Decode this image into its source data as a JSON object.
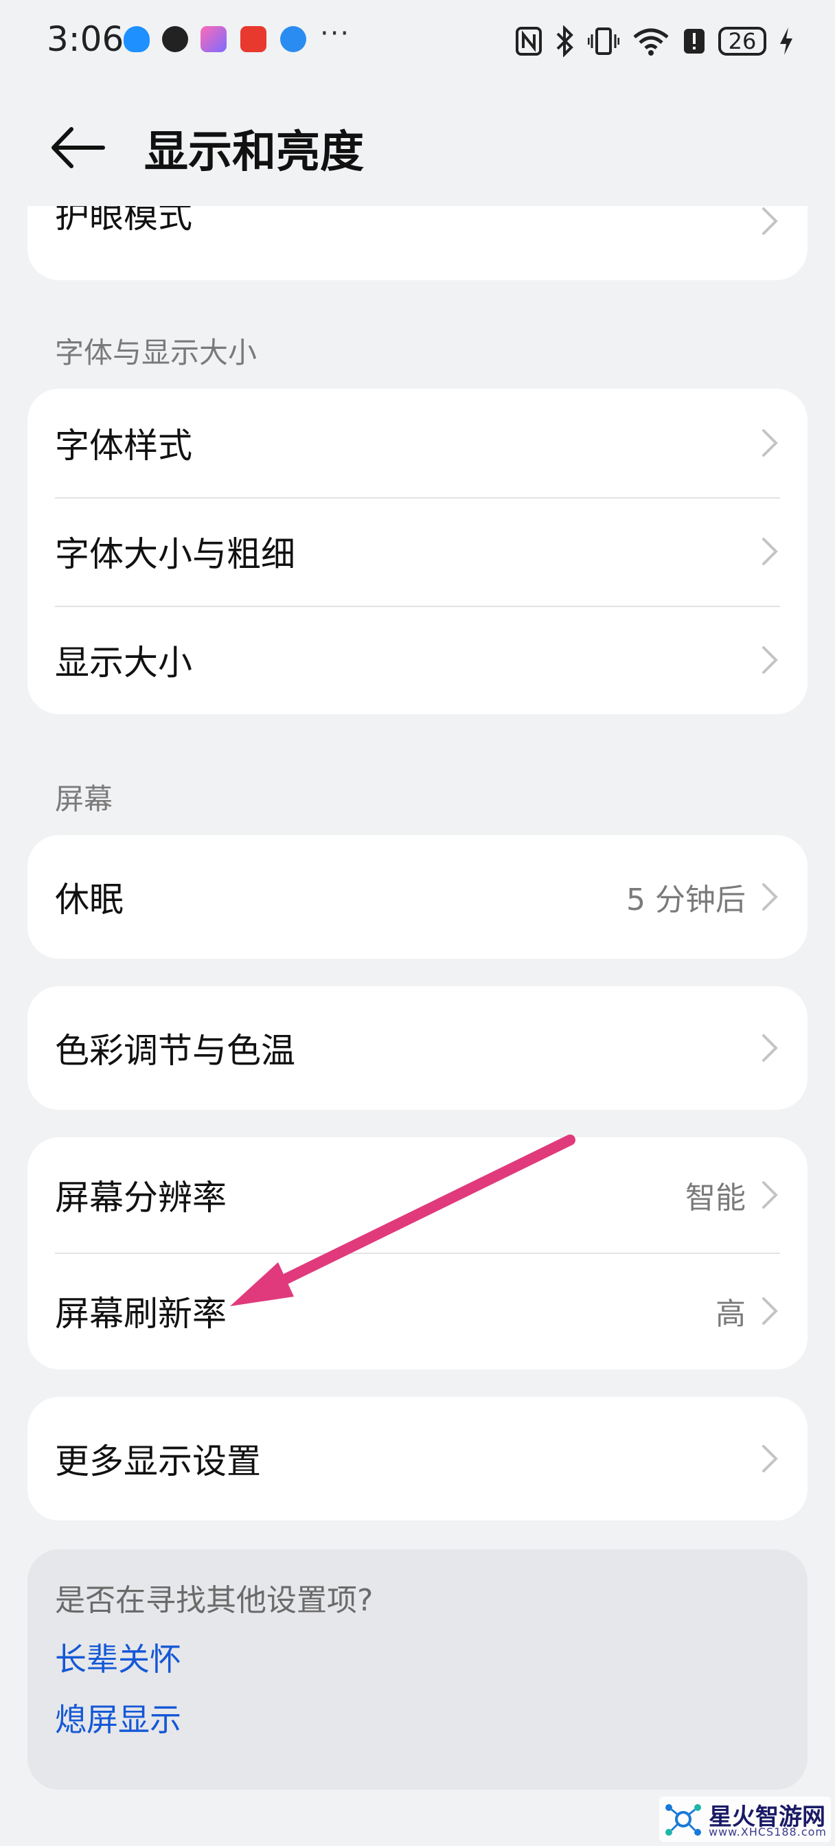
{
  "status": {
    "time": "3:06",
    "battery": "26",
    "icons": [
      "shield-app-icon",
      "qq-icon",
      "app-icon",
      "calendar-app-icon",
      "browser-icon",
      "nfc-icon",
      "bluetooth-icon",
      "vibrate-icon",
      "wifi-icon",
      "alert-icon",
      "charging-icon"
    ],
    "more": "···"
  },
  "header": {
    "title": "显示和亮度"
  },
  "top_partial": {
    "label": "护眼模式"
  },
  "sections": {
    "font_title": "字体与显示大小",
    "screen_title": "屏幕"
  },
  "font_items": [
    {
      "label": "字体样式"
    },
    {
      "label": "字体大小与粗细"
    },
    {
      "label": "显示大小"
    }
  ],
  "sleep": {
    "label": "休眠",
    "value": "5 分钟后"
  },
  "color": {
    "label": "色彩调节与色温"
  },
  "resolution": {
    "label": "屏幕分辨率",
    "value": "智能"
  },
  "refresh": {
    "label": "屏幕刷新率",
    "value": "高"
  },
  "more_display": {
    "label": "更多显示设置"
  },
  "suggest": {
    "question": "是否在寻找其他设置项?",
    "links": [
      "长辈关怀",
      "熄屏显示"
    ]
  },
  "watermark": {
    "title": "星火智游网",
    "sub": "www.XHCS188.com"
  },
  "colors": {
    "accent_link": "#1558d6",
    "annotation_arrow": "#e03a7d",
    "background": "#f1f2f4"
  }
}
